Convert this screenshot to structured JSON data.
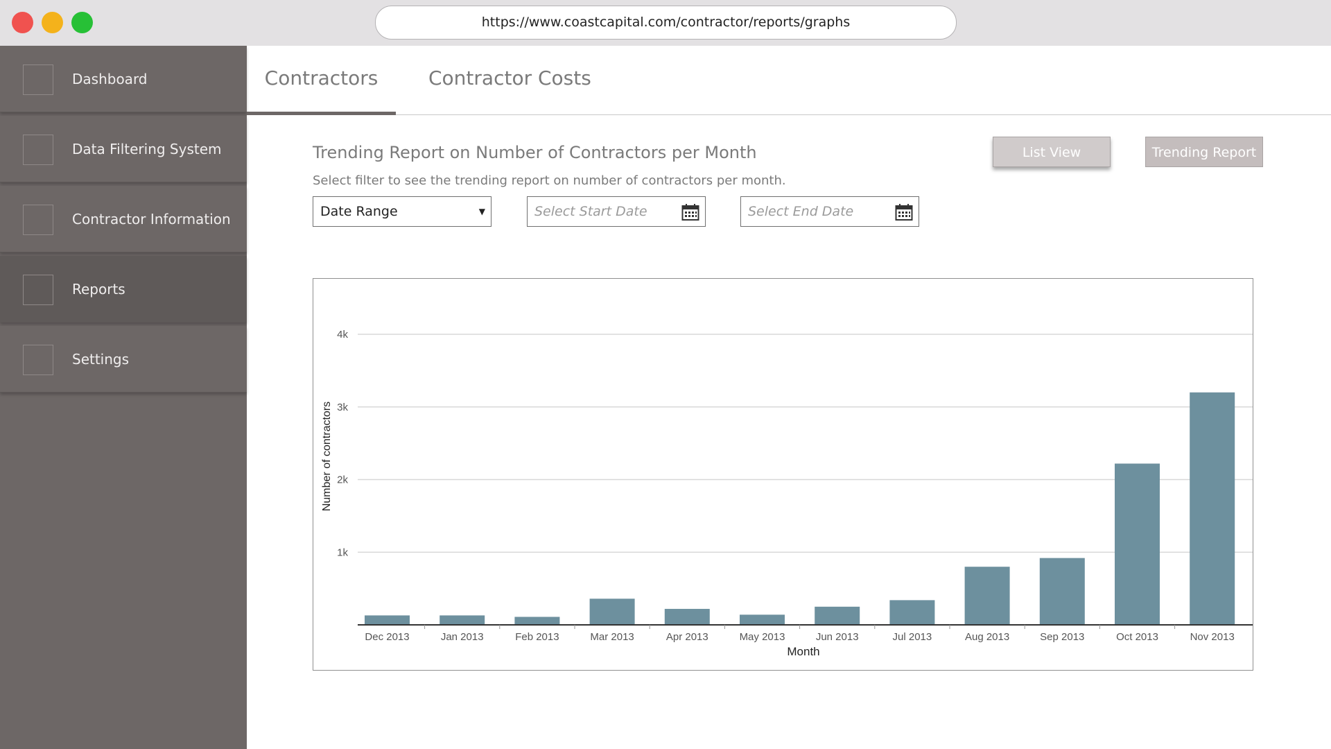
{
  "browser": {
    "url": "https://www.coastcapital.com/contractor/reports/graphs"
  },
  "sidebar": {
    "items": [
      {
        "label": "Dashboard"
      },
      {
        "label": "Data Filtering System"
      },
      {
        "label": "Contractor Information"
      },
      {
        "label": "Reports",
        "active": true
      },
      {
        "label": "Settings"
      }
    ]
  },
  "tabs": [
    {
      "label": "Contractors",
      "active": true
    },
    {
      "label": "Contractor Costs"
    }
  ],
  "report": {
    "title": "Trending Report on Number of Contractors per Month",
    "subtitle": "Select filter to see the trending report on number of contractors per month."
  },
  "buttons": {
    "list_view": "List View",
    "trending_report": "Trending Report"
  },
  "filters": {
    "range_select": "Date Range",
    "start_placeholder": "Select Start Date",
    "end_placeholder": "Select End Date",
    "calendar_icon": "calendar-icon"
  },
  "colors": {
    "bar": "#6d909e",
    "sidebar": "#6d6766",
    "grid": "#d8d8d8"
  },
  "chart_data": {
    "type": "bar",
    "categories": [
      "Dec 2013",
      "Jan 2013",
      "Feb 2013",
      "Mar 2013",
      "Apr 2013",
      "May 2013",
      "Jun 2013",
      "Jul 2013",
      "Aug 2013",
      "Sep 2013",
      "Oct 2013",
      "Nov 2013"
    ],
    "values": [
      130,
      130,
      110,
      360,
      220,
      140,
      250,
      340,
      800,
      920,
      2220,
      3200
    ],
    "xlabel": "Month",
    "ylabel": "Number of contractors",
    "ylim": [
      0,
      4000
    ],
    "yticks": [
      {
        "value": 1000,
        "label": "1k"
      },
      {
        "value": 2000,
        "label": "2k"
      },
      {
        "value": 3000,
        "label": "3k"
      },
      {
        "value": 4000,
        "label": "4k"
      }
    ],
    "grid": true
  }
}
